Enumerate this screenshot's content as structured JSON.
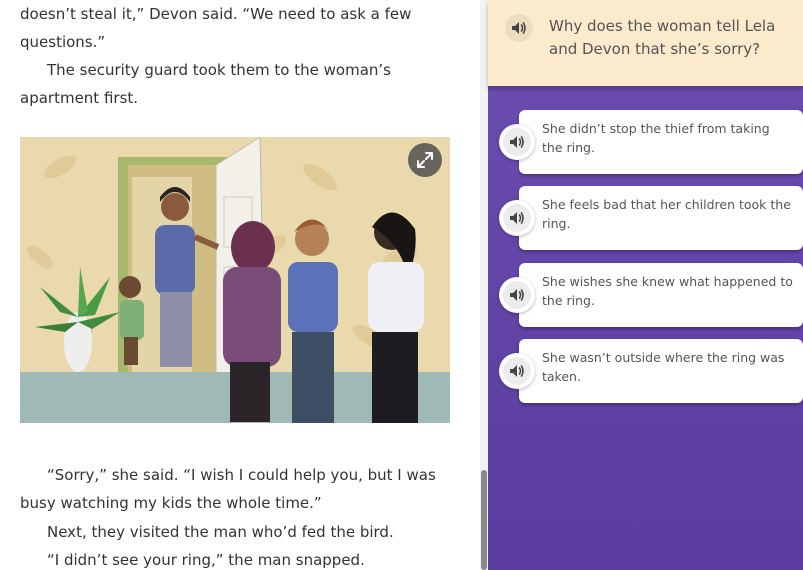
{
  "reader": {
    "paragraphs_top": [
      "doesn’t steal it,” Devon said. “We need to ask a few questions.”",
      "The security guard took them to the woman’s apartment first."
    ],
    "paragraphs_bottom": [
      "“Sorry,” she said. “I wish I could help you, but I was busy watching my kids the whole time.”",
      "Next, they visited the man who’d fed the bird.",
      "“I didn’t see your ring,” the man snapped."
    ],
    "illustration_icon": "expand-arrows-icon"
  },
  "question": {
    "audio_icon": "speaker-icon",
    "text": "Why does the woman tell Lela and Devon that she’s sorry?"
  },
  "choices": [
    {
      "text": "She didn’t stop the thief from taking the ring."
    },
    {
      "text": "She feels bad that her children took the ring."
    },
    {
      "text": "She wishes she knew what happened to the ring."
    },
    {
      "text": "She wasn’t outside where the ring was taken."
    }
  ],
  "colors": {
    "question_header_bg": "#fbeacb",
    "question_pane_bg": "#6c4fb0",
    "text": "#333333"
  }
}
